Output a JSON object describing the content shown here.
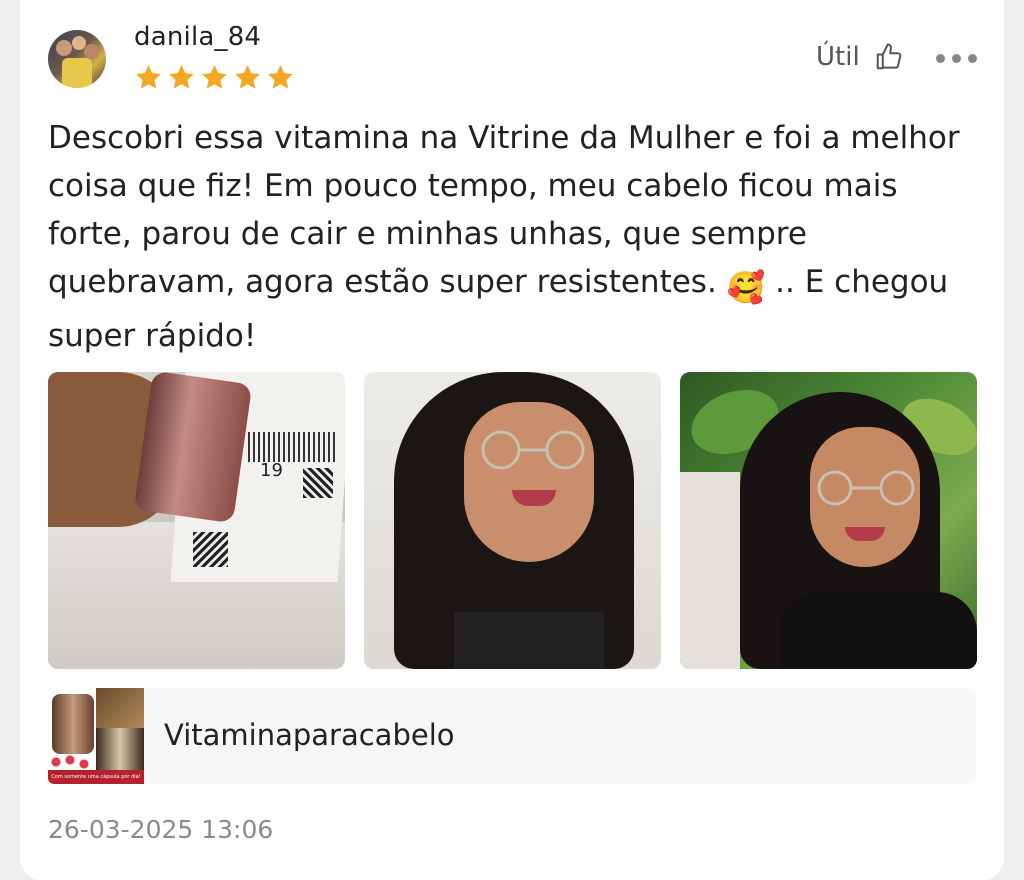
{
  "review": {
    "username": "danila_84",
    "rating": 5,
    "helpful_label": "Útil",
    "text_before_emoji": "Descobri essa vitamina na Vitrine da Mulher e foi a melhor coisa que fiz! Em pouco tempo, meu cabelo ficou mais forte, parou de cair e minhas unhas, que sempre quebravam, agora estão super resistentes.",
    "emoji": "🥰",
    "text_after_emoji": ".. E chegou super rápido!",
    "photos": [
      {
        "label_19": "19"
      },
      {},
      {}
    ],
    "product": {
      "name": "Vitaminaparacabelo",
      "image_caption": "Com somente uma cápsula por dia!"
    },
    "timestamp": "26-03-2025 13:06"
  },
  "colors": {
    "star": "#f5a623",
    "muted_text": "#8a8a8f",
    "product_bg": "#f6f6f7"
  },
  "icons": {
    "helpful": "thumbs-up-icon",
    "more": "more-horizontal-icon",
    "star": "star-icon"
  }
}
